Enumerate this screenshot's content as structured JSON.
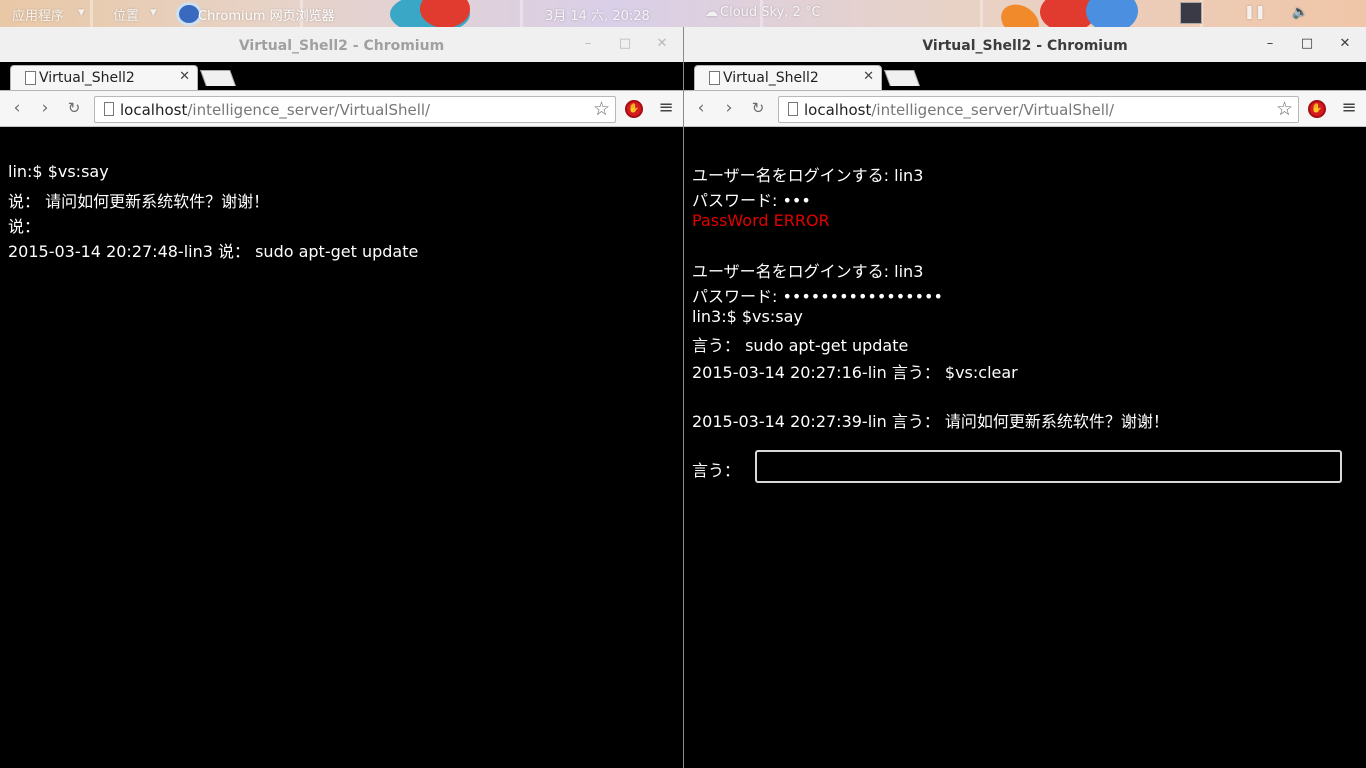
{
  "panel": {
    "apps_label": "应用程序",
    "places_label": "位置",
    "taskbar_label": "Chromium 网页浏览器",
    "clock": "3月 14 六, 20:28",
    "weather": "Cloud Sky, 2 °C"
  },
  "windows": {
    "left": {
      "title": "Virtual_Shell2 - Chromium",
      "tab_title": "Virtual_Shell2",
      "url_host": "localhost",
      "url_path": "/intelligence_server/VirtualShell/",
      "lines": [
        "lin:$  $vs:say",
        "说：  请问如何更新系统软件？谢谢！",
        "说：",
        "2015-03-14 20:27:48-lin3 说：  sudo apt-get update"
      ]
    },
    "right": {
      "title": "Virtual_Shell2 - Chromium",
      "tab_title": "Virtual_Shell2",
      "url_host": "localhost",
      "url_path": "/intelligence_server/VirtualShell/",
      "lines": [
        "ユーザー名をログインする: lin3",
        "パスワード: •••",
        "PassWord ERROR",
        "ユーザー名をログインする: lin3",
        "パスワード: •••••••••••••••••",
        "lin3:$  $vs:say",
        "言う：  sudo apt-get update",
        "2015-03-14 20:27:16-lin 言う：  $vs:clear",
        "2015-03-14 20:27:39-lin 言う：  请问如何更新系统软件？谢谢！",
        "言う："
      ],
      "input_value": ""
    }
  },
  "colors": {
    "error": "#e00000",
    "terminal_bg": "#000000",
    "terminal_fg": "#ffffff"
  }
}
